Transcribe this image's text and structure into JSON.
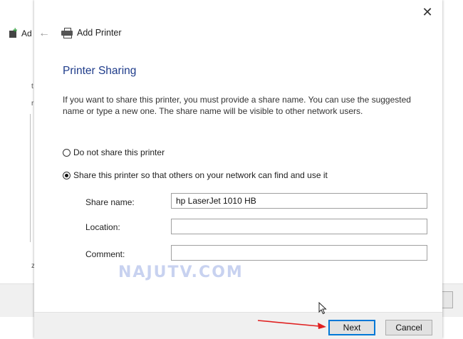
{
  "background": {
    "title": "Ad",
    "marks": [
      "t",
      "r",
      "z"
    ]
  },
  "dialog": {
    "title": "Add Printer",
    "page_title": "Printer Sharing",
    "description": "If you want to share this printer, you must provide a share name. You can use the suggested name or type a new one. The share name will be visible to other network users.",
    "options": [
      {
        "label": "Do not share this printer",
        "selected": false
      },
      {
        "label": "Share this printer so that others on your network can find and use it",
        "selected": true
      }
    ],
    "fields": {
      "share_name": {
        "label": "Share name:",
        "value": "hp LaserJet 1010 HB"
      },
      "location": {
        "label": "Location:",
        "value": ""
      },
      "comment": {
        "label": "Comment:",
        "value": ""
      }
    },
    "buttons": {
      "next": "Next",
      "cancel": "Cancel"
    }
  },
  "watermark": "NAJUTV.COM",
  "colors": {
    "title_blue": "#1e3b8a",
    "focus_border": "#0078d7",
    "annotation_red": "#e02020"
  }
}
